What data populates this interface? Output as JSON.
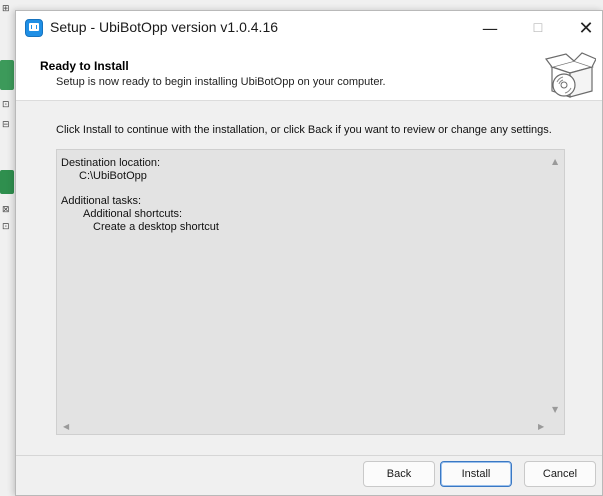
{
  "window": {
    "title": "Setup - UbiBotOpp version v1.0.4.16",
    "min_glyph": "—",
    "max_glyph": "☐",
    "close_glyph": "✕"
  },
  "header": {
    "title": "Ready to Install",
    "subtitle": "Setup is now ready to begin installing UbiBotOpp on your computer."
  },
  "body": {
    "intro": "Click Install to continue with the installation, or click Back if you want to review or change any settings.",
    "memo_lines": [
      "Destination location:",
      "C:\\UbiBotOpp",
      "Additional tasks:",
      "Additional shortcuts:",
      "Create a desktop shortcut"
    ]
  },
  "buttons": {
    "back": "Back",
    "install": "Install",
    "cancel": "Cancel"
  },
  "colors": {
    "accent": "#1f8fe5",
    "default_button_border": "#3a78c4",
    "memo_background": "#e3e3e3"
  },
  "icons": {
    "app": "ubibot-app-icon",
    "header": "software-box-cd-icon"
  }
}
